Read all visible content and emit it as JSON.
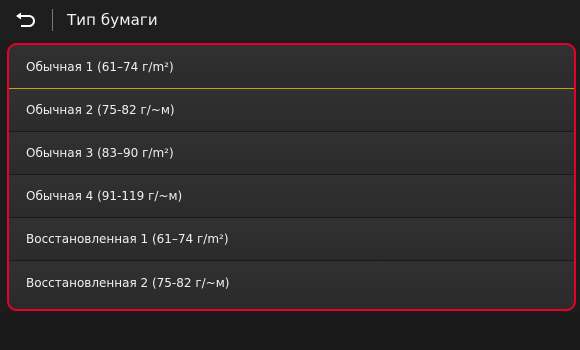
{
  "header": {
    "back_icon": "back-arrow-icon",
    "title": "Тип бумаги"
  },
  "list": {
    "items": [
      {
        "label": "Обычная 1 (61–74 г/m²)"
      },
      {
        "label": "Обычная 2 (75-82 г/~м)"
      },
      {
        "label": "Обычная 3 (83–90 г/m²)"
      },
      {
        "label": "Обычная 4 (91-119 г/~м)"
      },
      {
        "label": "Восстановленная 1 (61–74 г/m²)"
      },
      {
        "label": "Восстановленная 2 (75-82 г/~м)"
      }
    ]
  },
  "colors": {
    "highlight_border": "#e8002a",
    "selection_line": "#c8a000",
    "background": "#1c1c1c"
  }
}
